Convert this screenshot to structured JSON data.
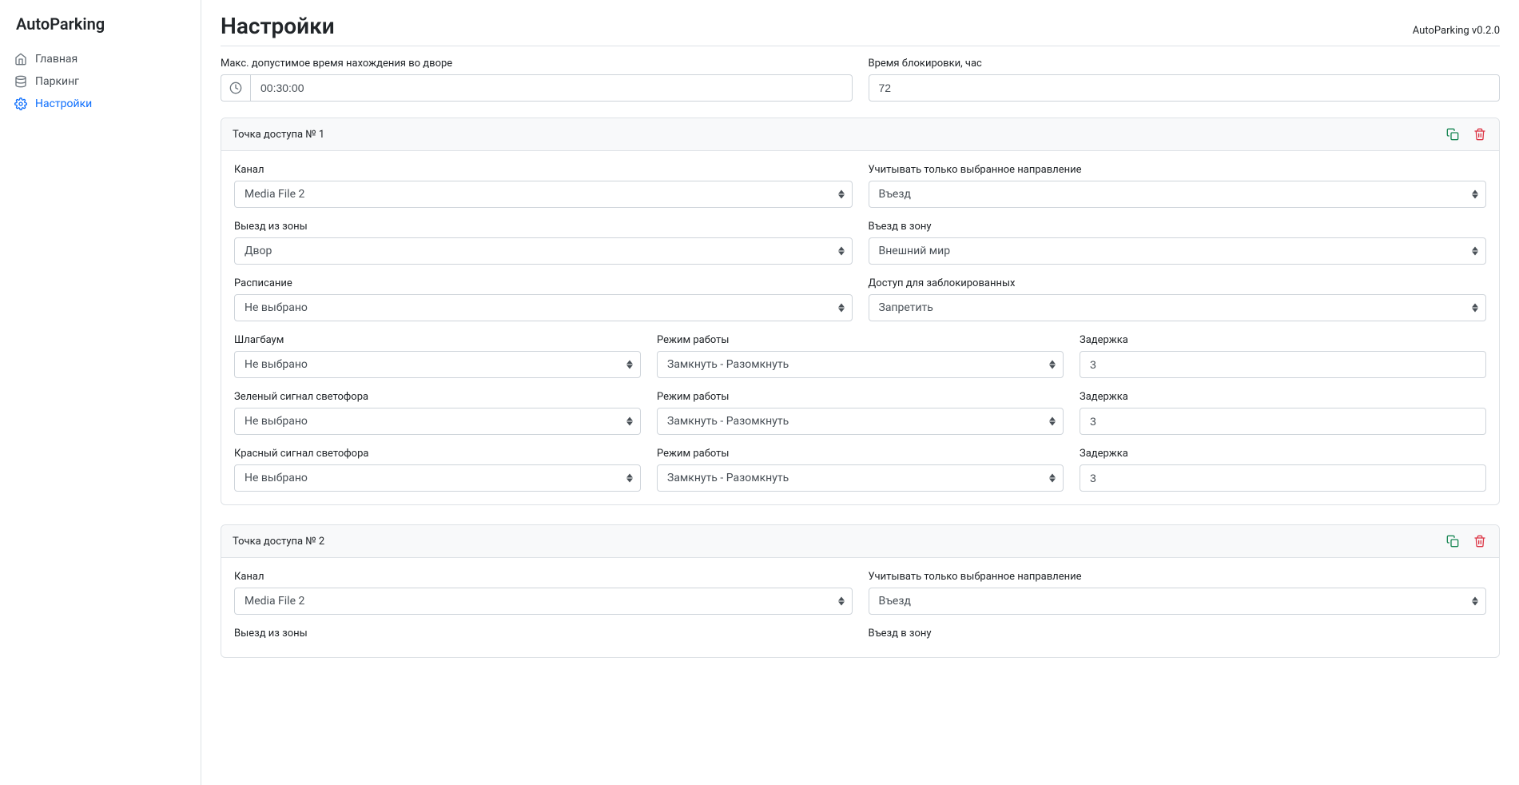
{
  "brand": "AutoParking",
  "version": "AutoParking v0.2.0",
  "nav": {
    "home": "Главная",
    "parking": "Паркинг",
    "settings": "Настройки"
  },
  "page_title": "Настройки",
  "labels": {
    "max_time": "Макс. допустимое время нахождения во дворе",
    "block_time": "Время блокировки, час",
    "channel": "Канал",
    "direction": "Учитывать только выбранное направление",
    "exit_zone": "Выезд из зоны",
    "entry_zone": "Въезд в зону",
    "schedule": "Расписание",
    "blocked_access": "Доступ для заблокированных",
    "barrier": "Шлагбаум",
    "mode": "Режим работы",
    "delay": "Задержка",
    "green_light": "Зеленый сигнал светофора",
    "red_light": "Красный сигнал светофора"
  },
  "top": {
    "max_time_value": "00:30:00",
    "block_time_value": "72"
  },
  "points": [
    {
      "title": "Точка доступа № 1",
      "channel": "Media File 2",
      "direction": "Въезд",
      "exit_zone": "Двор",
      "entry_zone": "Внешний мир",
      "schedule": "Не выбрано",
      "blocked_access": "Запретить",
      "barrier": "Не выбрано",
      "barrier_mode": "Замкнуть - Разомкнуть",
      "barrier_delay": "3",
      "green": "Не выбрано",
      "green_mode": "Замкнуть - Разомкнуть",
      "green_delay": "3",
      "red": "Не выбрано",
      "red_mode": "Замкнуть - Разомкнуть",
      "red_delay": "3"
    },
    {
      "title": "Точка доступа № 2",
      "channel": "Media File 2",
      "direction": "Въезд",
      "exit_zone": "",
      "entry_zone": ""
    }
  ]
}
